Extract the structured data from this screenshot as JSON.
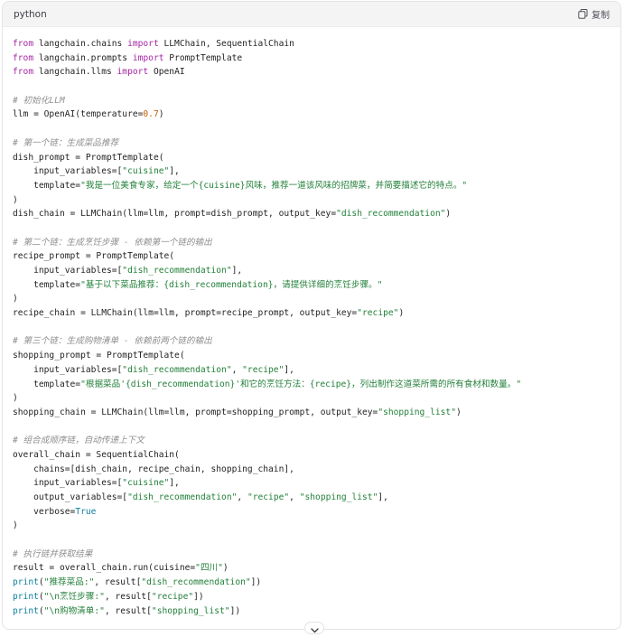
{
  "header": {
    "language": "python",
    "copy_label": "复制",
    "copy_icon": "copy-icon"
  },
  "code_lines": [
    [
      {
        "t": "kw",
        "v": "from"
      },
      {
        "t": "p",
        "v": " langchain.chains "
      },
      {
        "t": "kw",
        "v": "import"
      },
      {
        "t": "p",
        "v": " LLMChain, SequentialChain"
      }
    ],
    [
      {
        "t": "kw",
        "v": "from"
      },
      {
        "t": "p",
        "v": " langchain.prompts "
      },
      {
        "t": "kw",
        "v": "import"
      },
      {
        "t": "p",
        "v": " PromptTemplate"
      }
    ],
    [
      {
        "t": "kw",
        "v": "from"
      },
      {
        "t": "p",
        "v": " langchain.llms "
      },
      {
        "t": "kw",
        "v": "import"
      },
      {
        "t": "p",
        "v": " OpenAI"
      }
    ],
    [],
    [
      {
        "t": "cmt",
        "v": "# 初始化LLM"
      }
    ],
    [
      {
        "t": "p",
        "v": "llm = OpenAI(temperature="
      },
      {
        "t": "num",
        "v": "0.7"
      },
      {
        "t": "p",
        "v": ")"
      }
    ],
    [],
    [
      {
        "t": "cmt",
        "v": "# 第一个链：生成菜品推荐"
      }
    ],
    [
      {
        "t": "p",
        "v": "dish_prompt = PromptTemplate("
      }
    ],
    [
      {
        "t": "p",
        "v": "    input_variables=["
      },
      {
        "t": "str",
        "v": "\"cuisine\""
      },
      {
        "t": "p",
        "v": "],"
      }
    ],
    [
      {
        "t": "p",
        "v": "    template="
      },
      {
        "t": "str",
        "v": "\"我是一位美食专家，给定一个{cuisine}风味，推荐一道该风味的招牌菜，并简要描述它的特点。\""
      }
    ],
    [
      {
        "t": "p",
        "v": ")"
      }
    ],
    [
      {
        "t": "p",
        "v": "dish_chain = LLMChain(llm=llm, prompt=dish_prompt, output_key="
      },
      {
        "t": "str",
        "v": "\"dish_recommendation\""
      },
      {
        "t": "p",
        "v": ")"
      }
    ],
    [],
    [
      {
        "t": "cmt",
        "v": "# 第二个链：生成烹饪步骤 - 依赖第一个链的输出"
      }
    ],
    [
      {
        "t": "p",
        "v": "recipe_prompt = PromptTemplate("
      }
    ],
    [
      {
        "t": "p",
        "v": "    input_variables=["
      },
      {
        "t": "str",
        "v": "\"dish_recommendation\""
      },
      {
        "t": "p",
        "v": "],"
      }
    ],
    [
      {
        "t": "p",
        "v": "    template="
      },
      {
        "t": "str",
        "v": "\"基于以下菜品推荐：{dish_recommendation}，请提供详细的烹饪步骤。\""
      }
    ],
    [
      {
        "t": "p",
        "v": ")"
      }
    ],
    [
      {
        "t": "p",
        "v": "recipe_chain = LLMChain(llm=llm, prompt=recipe_prompt, output_key="
      },
      {
        "t": "str",
        "v": "\"recipe\""
      },
      {
        "t": "p",
        "v": ")"
      }
    ],
    [],
    [
      {
        "t": "cmt",
        "v": "# 第三个链：生成购物清单 - 依赖前两个链的输出"
      }
    ],
    [
      {
        "t": "p",
        "v": "shopping_prompt = PromptTemplate("
      }
    ],
    [
      {
        "t": "p",
        "v": "    input_variables=["
      },
      {
        "t": "str",
        "v": "\"dish_recommendation\""
      },
      {
        "t": "p",
        "v": ", "
      },
      {
        "t": "str",
        "v": "\"recipe\""
      },
      {
        "t": "p",
        "v": "],"
      }
    ],
    [
      {
        "t": "p",
        "v": "    template="
      },
      {
        "t": "str",
        "v": "\"根据菜品'{dish_recommendation}'和它的烹饪方法：{recipe}，列出制作这道菜所需的所有食材和数量。\""
      }
    ],
    [
      {
        "t": "p",
        "v": ")"
      }
    ],
    [
      {
        "t": "p",
        "v": "shopping_chain = LLMChain(llm=llm, prompt=shopping_prompt, output_key="
      },
      {
        "t": "str",
        "v": "\"shopping_list\""
      },
      {
        "t": "p",
        "v": ")"
      }
    ],
    [],
    [
      {
        "t": "cmt",
        "v": "# 组合成顺序链，自动传递上下文"
      }
    ],
    [
      {
        "t": "p",
        "v": "overall_chain = SequentialChain("
      }
    ],
    [
      {
        "t": "p",
        "v": "    chains=[dish_chain, recipe_chain, shopping_chain],"
      }
    ],
    [
      {
        "t": "p",
        "v": "    input_variables=["
      },
      {
        "t": "str",
        "v": "\"cuisine\""
      },
      {
        "t": "p",
        "v": "],"
      }
    ],
    [
      {
        "t": "p",
        "v": "    output_variables=["
      },
      {
        "t": "str",
        "v": "\"dish_recommendation\""
      },
      {
        "t": "p",
        "v": ", "
      },
      {
        "t": "str",
        "v": "\"recipe\""
      },
      {
        "t": "p",
        "v": ", "
      },
      {
        "t": "str",
        "v": "\"shopping_list\""
      },
      {
        "t": "p",
        "v": "],"
      }
    ],
    [
      {
        "t": "p",
        "v": "    verbose="
      },
      {
        "t": "kwc",
        "v": "True"
      }
    ],
    [
      {
        "t": "p",
        "v": ")"
      }
    ],
    [],
    [
      {
        "t": "cmt",
        "v": "# 执行链并获取结果"
      }
    ],
    [
      {
        "t": "p",
        "v": "result = overall_chain.run(cuisine="
      },
      {
        "t": "str",
        "v": "\"四川\""
      },
      {
        "t": "p",
        "v": ")"
      }
    ],
    [
      {
        "t": "kwc",
        "v": "print"
      },
      {
        "t": "p",
        "v": "("
      },
      {
        "t": "str",
        "v": "\"推荐菜品:\""
      },
      {
        "t": "p",
        "v": ", result["
      },
      {
        "t": "str",
        "v": "\"dish_recommendation\""
      },
      {
        "t": "p",
        "v": "])"
      }
    ],
    [
      {
        "t": "kwc",
        "v": "print"
      },
      {
        "t": "p",
        "v": "("
      },
      {
        "t": "str",
        "v": "\"\\n烹饪步骤:\""
      },
      {
        "t": "p",
        "v": ", result["
      },
      {
        "t": "str",
        "v": "\"recipe\""
      },
      {
        "t": "p",
        "v": "])"
      }
    ],
    [
      {
        "t": "kwc",
        "v": "print"
      },
      {
        "t": "p",
        "v": "("
      },
      {
        "t": "str",
        "v": "\"\\n购物清单:\""
      },
      {
        "t": "p",
        "v": ", result["
      },
      {
        "t": "str",
        "v": "\"shopping_list\""
      },
      {
        "t": "p",
        "v": "])"
      }
    ]
  ],
  "scroll_button": {
    "icon": "chevron-down-icon"
  }
}
